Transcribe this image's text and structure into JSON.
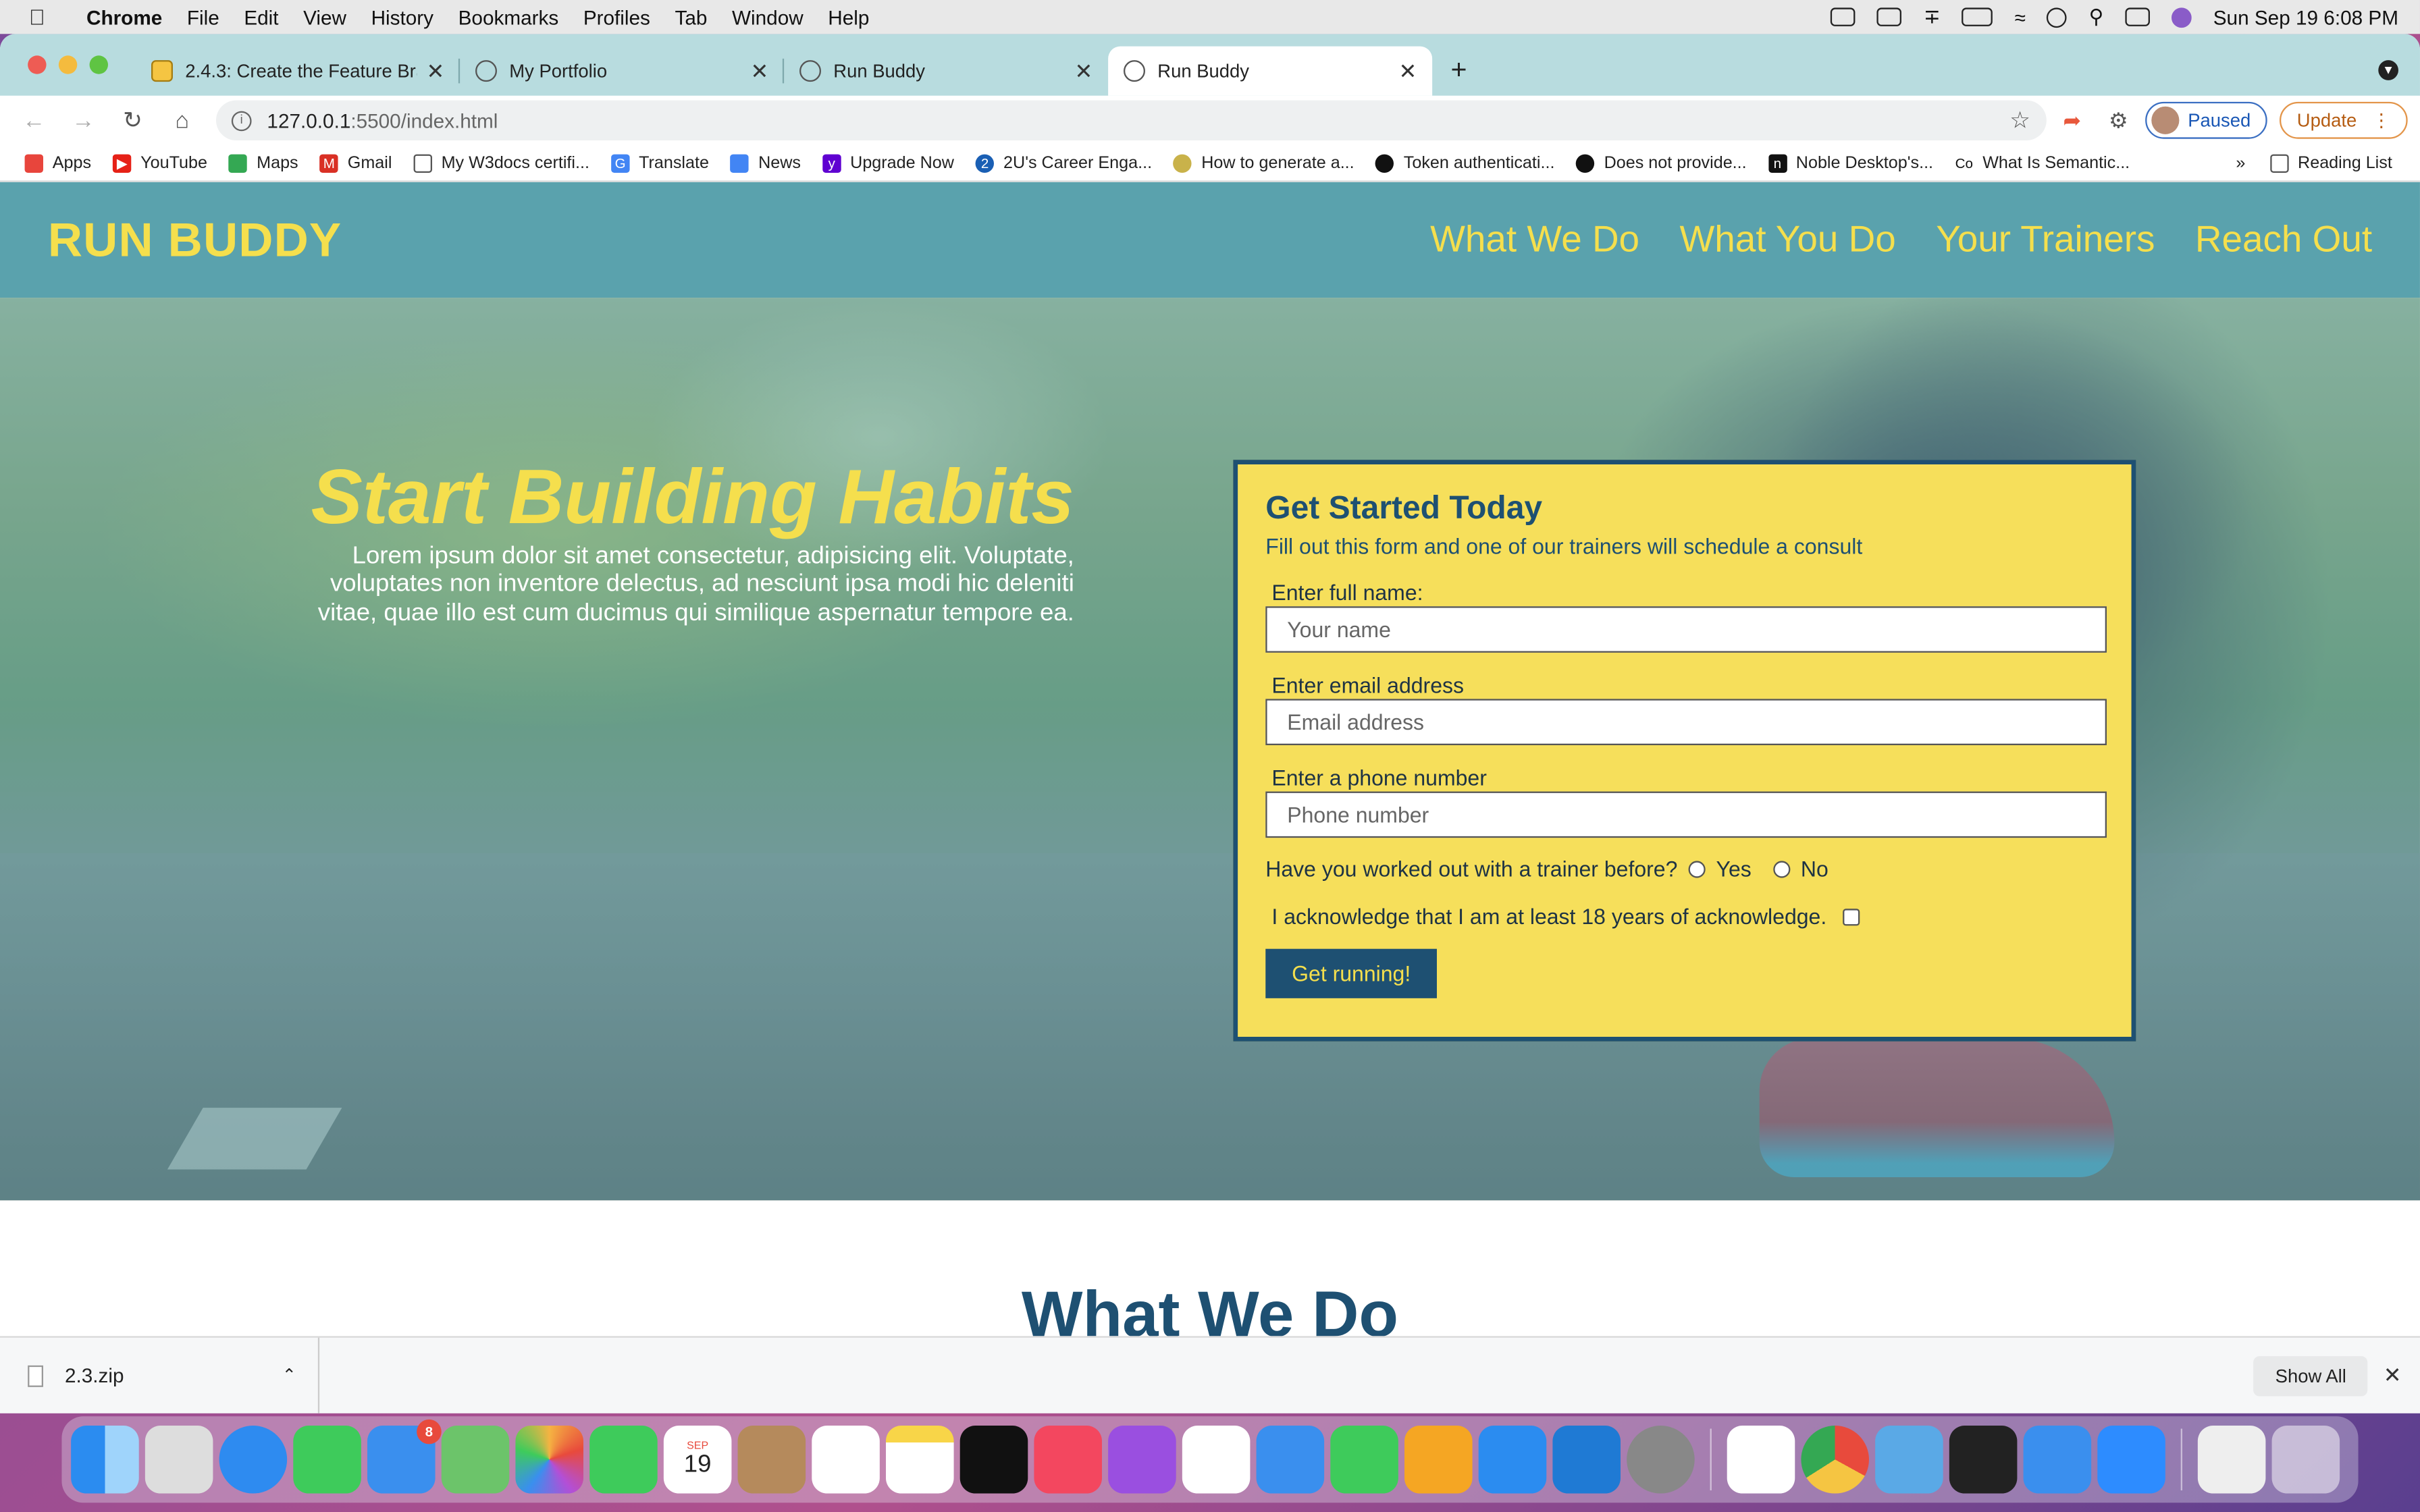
{
  "menubar": {
    "app": "Chrome",
    "items": [
      "File",
      "Edit",
      "View",
      "History",
      "Bookmarks",
      "Profiles",
      "Tab",
      "Window",
      "Help"
    ],
    "datetime": "Sun Sep 19  6:08 PM"
  },
  "tabs": [
    {
      "title": "2.4.3: Create the Feature Bran",
      "active": false
    },
    {
      "title": "My Portfolio",
      "active": false
    },
    {
      "title": "Run Buddy",
      "active": false
    },
    {
      "title": "Run Buddy",
      "active": true
    }
  ],
  "toolbar": {
    "url_host": "127.0.0.1",
    "url_path": ":5500/index.html",
    "profile_label": "Paused",
    "update_label": "Update"
  },
  "bookmarks": {
    "items": [
      "Apps",
      "YouTube",
      "Maps",
      "Gmail",
      "My W3docs certifi...",
      "Translate",
      "News",
      "Upgrade Now",
      "2U's Career Enga...",
      "How to generate a...",
      "Token authenticati...",
      "Does not provide...",
      "Noble Desktop's...",
      "What Is Semantic..."
    ],
    "overflow": "»",
    "reading_list": "Reading List"
  },
  "site": {
    "logo": "RUN BUDDY",
    "nav": [
      "What We Do",
      "What You Do",
      "Your Trainers",
      "Reach Out"
    ],
    "hero": {
      "title": "Start Building Habits",
      "text": "Lorem ipsum dolor sit amet consectetur, adipisicing elit. Voluptate, voluptates non inventore delectus, ad nesciunt ipsa modi hic deleniti vitae, quae illo est cum ducimus qui similique aspernatur tempore ea."
    },
    "form": {
      "title": "Get Started Today",
      "subtitle": "Fill out this form and one of our trainers will schedule a consult",
      "name_label": "Enter full name:",
      "name_placeholder": "Your name",
      "email_label": "Enter email address",
      "email_placeholder": "Email address",
      "phone_label": "Enter a phone number",
      "phone_placeholder": "Phone number",
      "trainer_question": "Have you worked out with a trainer before?",
      "yes_label": "Yes",
      "no_label": "No",
      "acknowledge_label": "I acknowledge that I am at least 18 years of acknowledge.",
      "submit_label": "Get running!"
    },
    "section_title": "What We Do"
  },
  "downloads": {
    "file": "2.3.zip",
    "show_all": "Show All"
  },
  "dock": {
    "calendar_month": "SEP",
    "calendar_day": "19",
    "mail_badge": "8"
  },
  "colors": {
    "header_bg": "#5aa2ad",
    "brand_yellow": "#f5df4d",
    "brand_navy": "#1e5072",
    "form_bg": "#f6df5b"
  }
}
